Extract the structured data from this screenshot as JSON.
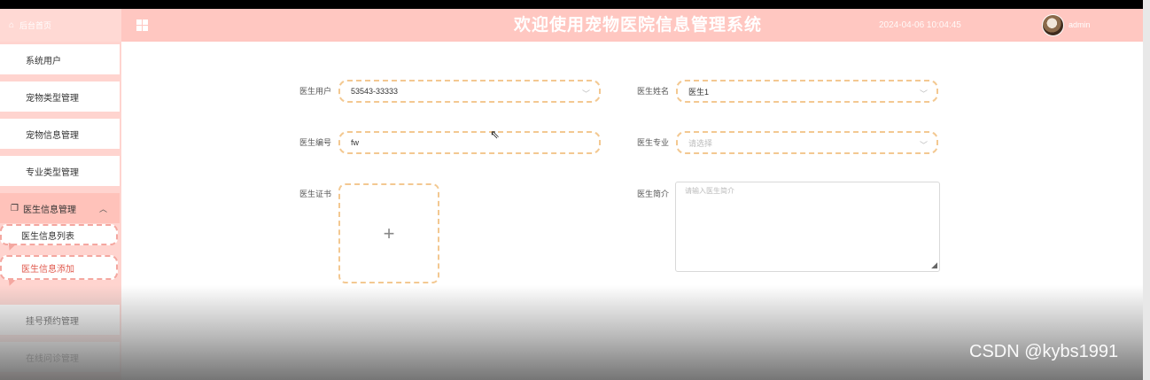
{
  "header": {
    "home_label": "后台首页",
    "title": "欢迎使用宠物医院信息管理系统",
    "datetime": "2024-04-06 10:04:45",
    "user": "admin"
  },
  "sidebar": {
    "items": [
      {
        "label": "系统用户"
      },
      {
        "label": "宠物类型管理"
      },
      {
        "label": "宠物信息管理"
      },
      {
        "label": "专业类型管理"
      },
      {
        "label": "医生信息管理"
      },
      {
        "label": "挂号预约管理"
      },
      {
        "label": "在线问诊管理"
      }
    ],
    "submenu": [
      {
        "label": "医生信息列表"
      },
      {
        "label": "医生信息添加"
      }
    ]
  },
  "form": {
    "doctor_user_label": "医生用户",
    "doctor_user_value": "53543-33333",
    "doctor_name_label": "医生姓名",
    "doctor_name_value": "医生1",
    "doctor_no_label": "医生编号",
    "doctor_no_value": "fw",
    "doctor_major_label": "医生专业",
    "doctor_major_placeholder": "请选择",
    "doctor_cert_label": "医生证书",
    "doctor_intro_label": "医生简介",
    "doctor_intro_placeholder": "请输入医生简介"
  },
  "watermark": "CSDN @kybs1991"
}
